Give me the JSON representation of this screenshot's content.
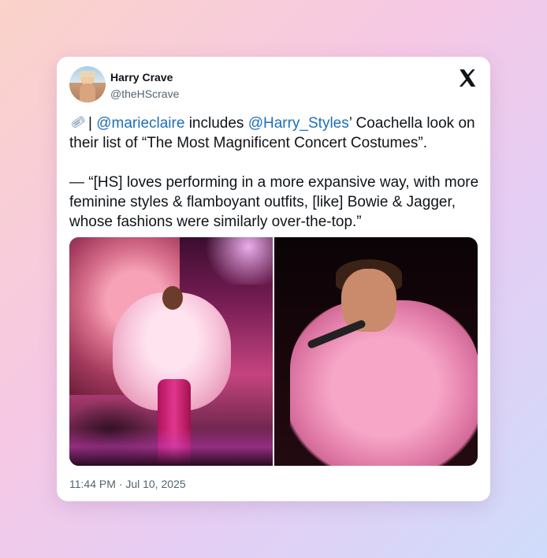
{
  "author": {
    "name": "Harry Crave",
    "handle": "@theHScrave"
  },
  "post": {
    "emoji_icon": "newspaper-roll-icon",
    "separator": "| ",
    "mention1": "@marieclaire",
    "text1": " includes ",
    "mention2": "@Harry_Styles",
    "text2": "’ Coachella look on their list of “The Most Magnificent Concert Costumes”.",
    "quote": "— “[HS] loves performing in a more expansive way, with more feminine styles & flamboyant outfits, [like] Bowie & Jagger, whose fashions were similarly over-the-top.”"
  },
  "media": {
    "left_photo": "performer-stage-photo",
    "right_photo": "performer-closeup-photo"
  },
  "timestamp": "11:44 PM · Jul 10, 2025",
  "colors": {
    "mention": "#1d6fb8",
    "text": "#0f1419",
    "secondary": "#536471"
  }
}
